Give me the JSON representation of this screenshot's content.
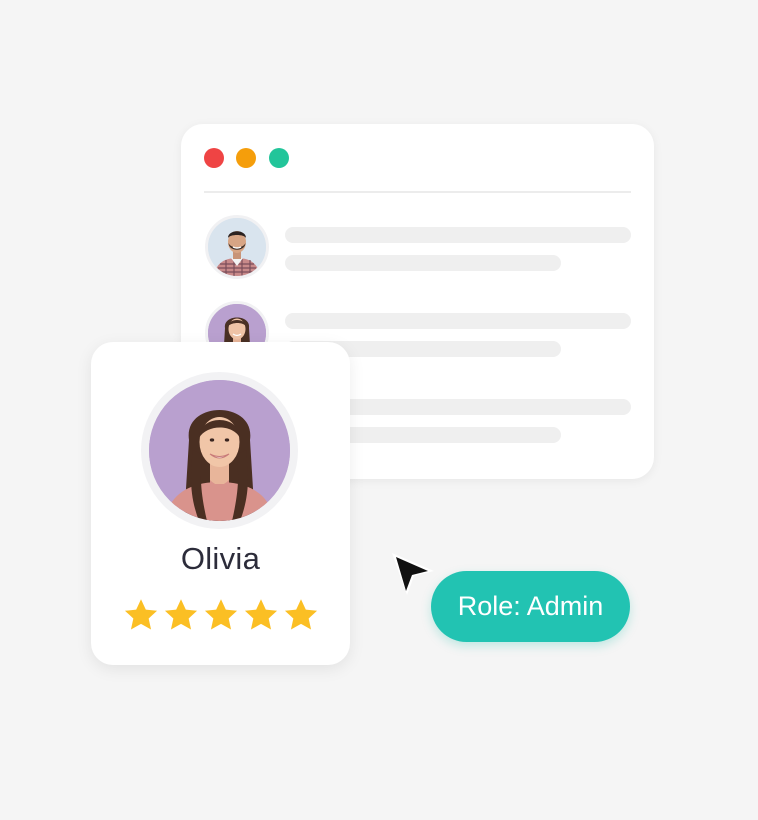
{
  "colors": {
    "background": "#f5f5f5",
    "window_dot_red": "#ef4444",
    "window_dot_orange": "#f59e0b",
    "window_dot_green": "#22c59a",
    "star": "#fbbf24",
    "role_pill": "#22c3b2"
  },
  "window": {
    "controls": [
      {
        "name": "close",
        "color": "#ef4444"
      },
      {
        "name": "minimize",
        "color": "#f59e0b"
      },
      {
        "name": "maximize",
        "color": "#22c59a"
      }
    ],
    "rows": [
      {
        "avatar_icon": "man-portrait-avatar"
      },
      {
        "avatar_icon": "woman-portrait-avatar"
      },
      {
        "avatar_icon": "hidden-avatar"
      }
    ]
  },
  "profile": {
    "name": "Olivia",
    "avatar_icon": "woman-portrait-avatar",
    "rating": 5,
    "rating_max": 5
  },
  "role_pill": {
    "label": "Role: Admin"
  },
  "cursor": {
    "icon": "pointer-arrow-icon"
  }
}
